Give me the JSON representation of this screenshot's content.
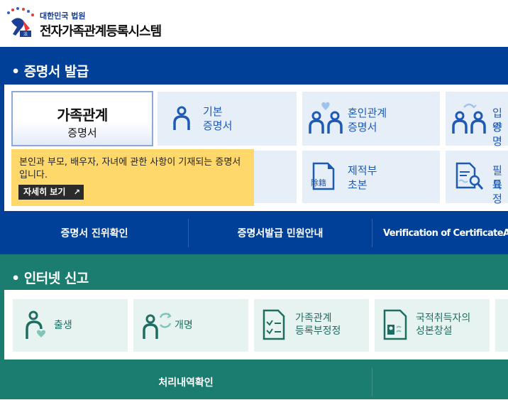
{
  "header": {
    "org_name": "대한민국 법원",
    "system_name": "전자가족관계등록시스템"
  },
  "certificate_section": {
    "title": "• 증명서 발급",
    "cards": [
      {
        "line1": "가족관계",
        "line2": "증명서",
        "icon": "person-icon-active"
      },
      {
        "line1": "기본",
        "line2": "증명서",
        "icon": "person-icon"
      },
      {
        "line1": "혼인관계",
        "line2": "증명서",
        "icon": "couple-heart-icon"
      },
      {
        "line1": "입양",
        "line2": "증명",
        "icon": "adoption-icon"
      },
      {
        "line1": "제적부",
        "line2": "초본",
        "icon": "register-document-icon",
        "icon_text": "除籍"
      },
      {
        "line1": "필요",
        "line2": "특정",
        "icon": "search-document-icon"
      }
    ],
    "tooltip": {
      "description": "본인과 부모, 배우자, 자녀에 관한 사항이 기재되는 증명서입니다.",
      "more_button": "자세히 보기",
      "more_icon": "external-link-icon"
    },
    "nav": [
      "증명서 진위확인",
      "증명서발급 민원안내",
      "Verification of CertificateAuthenticity"
    ]
  },
  "report_section": {
    "title": "• 인터넷 신고",
    "cards": [
      {
        "label": "출생",
        "icon": "birth-icon"
      },
      {
        "label": "개명",
        "icon": "rename-icon"
      },
      {
        "line1": "가족관계",
        "line2": "등록부정정",
        "icon": "correction-document-icon"
      },
      {
        "line1": "국적취득자의",
        "line2": "성본창설",
        "icon": "id-card-icon"
      }
    ],
    "nav": [
      "처리내역확인"
    ]
  },
  "colors": {
    "blue": "#004098",
    "green": "#1a7d6f",
    "tooltip": "#ffd86b"
  }
}
